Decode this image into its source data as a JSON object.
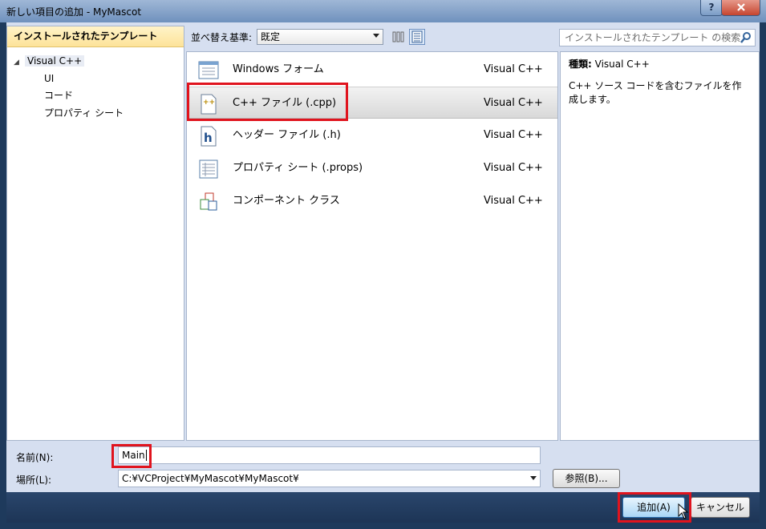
{
  "window": {
    "title": "新しい項目の追加 - MyMascot",
    "help_label": "?",
    "close_label": "x"
  },
  "left_panel": {
    "header": "インストールされたテンプレート",
    "tree": {
      "root": "Visual C++",
      "children": [
        "UI",
        "コード",
        "プロパティ シート"
      ]
    }
  },
  "toolbar": {
    "sort_label": "並べ替え基準:",
    "sort_value": "既定",
    "search_placeholder": "インストールされたテンプレート の検索"
  },
  "templates": [
    {
      "name": "Windows フォーム",
      "language": "Visual C++",
      "icon": "windows-form-icon"
    },
    {
      "name": "C++ ファイル (.cpp)",
      "language": "Visual C++",
      "icon": "cpp-file-icon",
      "selected": true
    },
    {
      "name": "ヘッダー ファイル (.h)",
      "language": "Visual C++",
      "icon": "header-file-icon"
    },
    {
      "name": "プロパティ シート (.props)",
      "language": "Visual C++",
      "icon": "property-sheet-icon"
    },
    {
      "name": "コンポーネント クラス",
      "language": "Visual C++",
      "icon": "component-class-icon"
    }
  ],
  "details": {
    "type_label": "種類:",
    "type_value": "Visual C++",
    "description": "C++ ソース コードを含むファイルを作成します。"
  },
  "form": {
    "name_label": "名前(N):",
    "name_value": "Main",
    "location_label": "場所(L):",
    "location_value": "C:¥VCProject¥MyMascot¥MyMascot¥",
    "browse_label": "参照(B)..."
  },
  "buttons": {
    "add_label": "追加(A)",
    "cancel_label": "キャンセル"
  },
  "colors": {
    "highlight": "#e0141e",
    "selection_header": "#fde39a",
    "dialog_bg": "#d6dff0"
  }
}
